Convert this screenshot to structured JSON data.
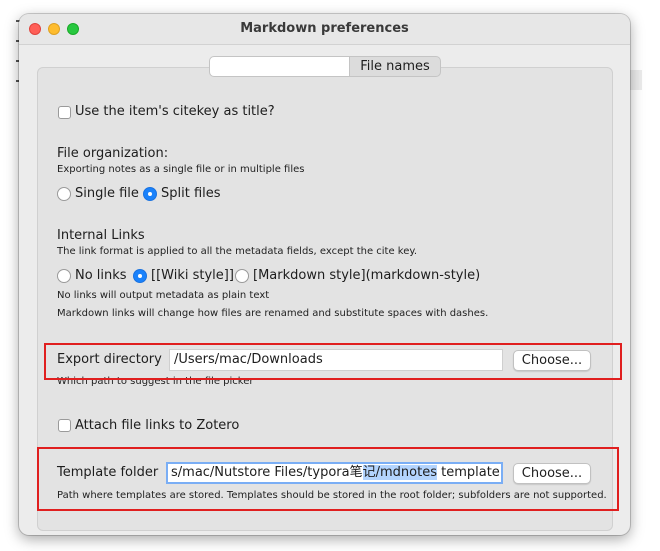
{
  "window": {
    "title": "Markdown preferences"
  },
  "tabs": {
    "blank_label": "",
    "active_label": "File names"
  },
  "citekey": {
    "label": "Use the item's citekey as title?",
    "checked": false
  },
  "file_org": {
    "heading": "File organization:",
    "description": "Exporting notes as a single file or in multiple files",
    "options": [
      {
        "label": "Single file",
        "selected": false
      },
      {
        "label": "Split files",
        "selected": true
      }
    ]
  },
  "internal_links": {
    "heading": "Internal Links",
    "description": "The link format is applied to all the metadata fields, except the cite key.",
    "options": [
      {
        "label": "No links",
        "selected": false
      },
      {
        "label": "[[Wiki style]]",
        "selected": true
      },
      {
        "label": "[Markdown style](markdown-style)",
        "selected": false
      }
    ],
    "note1": "No links will output metadata as plain text",
    "note2": "Markdown links will change how files are renamed and substitute spaces with dashes."
  },
  "export_dir": {
    "label": "Export directory",
    "value": "/Users/mac/Downloads",
    "button": "Choose...",
    "hint": "Which path to suggest in the file picker"
  },
  "attach": {
    "label": "Attach file links to Zotero",
    "checked": false
  },
  "template": {
    "label": "Template folder",
    "value_before": "s/mac/Nutstore Files/typora笔",
    "value_selected": "记/mdnotes",
    "value_after": " template",
    "button": "Choose...",
    "hint": "Path where templates are stored. Templates should be stored in the root folder; subfolders are not supported."
  },
  "colors": {
    "accent": "#1a82fb",
    "highlight": "#e01f1f",
    "selection": "#b3d4fe"
  }
}
